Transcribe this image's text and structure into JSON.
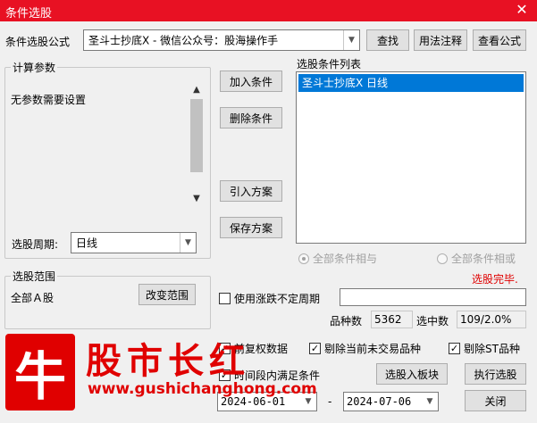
{
  "window": {
    "title": "条件选股",
    "close_glyph": "✕"
  },
  "formula": {
    "label": "条件选股公式",
    "value": "圣斗士抄底X  -  微信公众号：股海操作手",
    "find_label": "查找",
    "usage_label": "用法注释",
    "view_label": "查看公式"
  },
  "params": {
    "title": "计算参数",
    "text": "无参数需要设置",
    "period_label": "选股周期:",
    "period_value": "日线"
  },
  "actions": {
    "add_label": "加入条件",
    "delete_label": "删除条件",
    "import_label": "引入方案",
    "save_label": "保存方案"
  },
  "conditions": {
    "title": "选股条件列表",
    "items": [
      "圣斗士抄底X  日线"
    ],
    "all_and_label": "全部条件相与",
    "all_or_label": "全部条件相或",
    "status": "选股完毕.",
    "status_color": "#e00000"
  },
  "range": {
    "title": "选股范围",
    "value": "全部Ａ股",
    "change_label": "改变范围"
  },
  "options": {
    "uncertain_period_label": "使用涨跌不定周期",
    "reweight_label": "前复权数据",
    "exclude_untraded_label": "剔除当前未交易品种",
    "exclude_st_label": "剔除ST品种",
    "time_range_label": "时间段内满足条件"
  },
  "stats": {
    "count_label": "品种数",
    "count_value": "5362",
    "selected_label": "选中数",
    "selected_value": "109/2.0%"
  },
  "dates": {
    "start": "2024-06-01",
    "sep": "-",
    "end": "2024-07-06"
  },
  "buttons": {
    "to_block_label": "选股入板块",
    "execute_label": "执行选股",
    "close_label": "关闭"
  },
  "watermark": {
    "logo_char": "牛",
    "name": "股市长红",
    "url": "www.gushichanghong.com",
    "color": "#e00000"
  }
}
